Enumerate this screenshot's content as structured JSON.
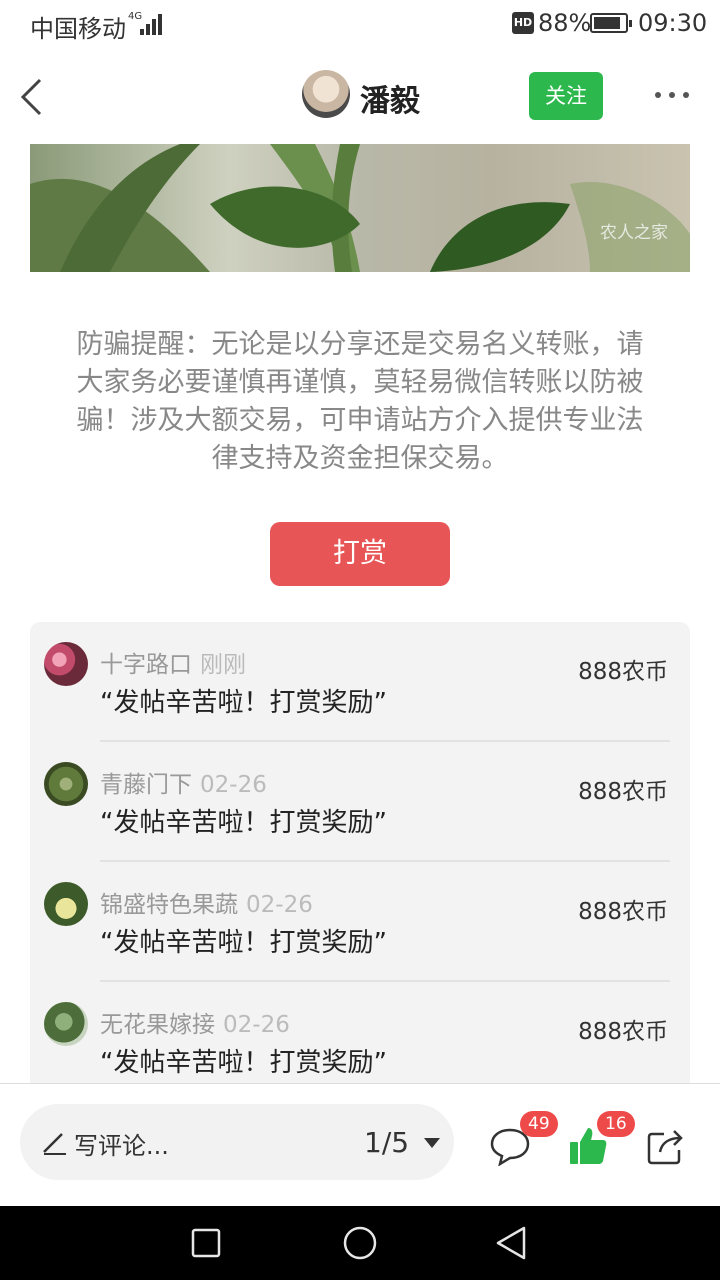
{
  "status_bar": {
    "carrier": "中国移动",
    "network": "4G",
    "hd": "HD",
    "battery_percent": "88%",
    "battery_level": 0.88,
    "time": "09:30"
  },
  "header": {
    "back_icon": "chevron-left-icon",
    "user_name": "潘毅",
    "follow_label": "关注",
    "more_icon": "more-dots-icon"
  },
  "photo": {
    "watermark": "农人之家"
  },
  "reminder": "防骗提醒：无论是以分享还是交易名义转账，请大家务必要谨慎再谨慎，莫轻易微信转账以防被骗！涉及大额交易，可申请站方介入提供专业法律支持及资金担保交易。",
  "tip_button": "打赏",
  "rewards": [
    {
      "name": "十字路口",
      "time": "刚刚",
      "message": "“发帖辛苦啦！打赏奖励”",
      "amount": "888农币"
    },
    {
      "name": "青藤门下",
      "time": "02-26",
      "message": "“发帖辛苦啦！打赏奖励”",
      "amount": "888农币"
    },
    {
      "name": "锦盛特色果蔬",
      "time": "02-26",
      "message": "“发帖辛苦啦！打赏奖励”",
      "amount": "888农币"
    },
    {
      "name": "无花果嫁接",
      "time": "02-26",
      "message": "“发帖辛苦啦！打赏奖励”",
      "amount": "888农币"
    }
  ],
  "bottom_bar": {
    "comment_placeholder": "写评论...",
    "page_indicator": "1/5",
    "comment_count": "49",
    "like_count": "16",
    "icons": [
      "pencil-icon",
      "comment-icon",
      "thumbs-up-icon",
      "share-icon"
    ],
    "like_color": "#2db84d"
  },
  "nav_bar": {
    "icons": [
      "recent-apps-icon",
      "home-icon",
      "back-icon"
    ]
  }
}
